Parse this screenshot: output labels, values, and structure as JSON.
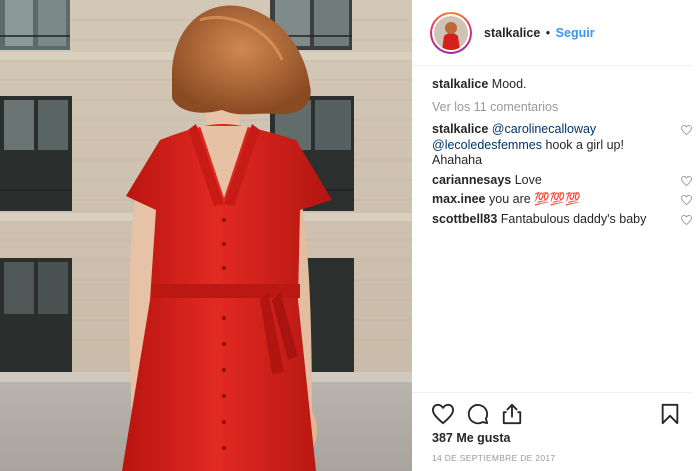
{
  "post": {
    "username": "stalkalice",
    "separator": "•",
    "follow_label": "Seguir",
    "caption_user": "stalkalice",
    "caption_text": "Mood.",
    "view_comments_label": "Ver los 11 comentarios",
    "comments": [
      {
        "user": "stalkalice",
        "mention1": "@carolinecalloway",
        "mention2": "@lecoledesfemmes",
        "text": " hook a girl up! Ahahaha"
      },
      {
        "user": "cariannesays",
        "text": "Love"
      },
      {
        "user": "max.inee",
        "text": "you are 💯💯💯"
      },
      {
        "user": "scottbell83",
        "text": "Fantabulous daddy's baby"
      }
    ],
    "likes_label": "387 Me gusta",
    "date_label": "14 DE SEPTIEMBRE DE 2017"
  },
  "icons": {
    "like": "heart-icon",
    "comment": "comment-bubble-icon",
    "share": "share-icon",
    "save": "bookmark-icon",
    "comment_like": "heart-icon"
  },
  "colors": {
    "link": "#3897f0",
    "mention": "#003569",
    "muted": "#999999",
    "dress": "#d4201c"
  }
}
